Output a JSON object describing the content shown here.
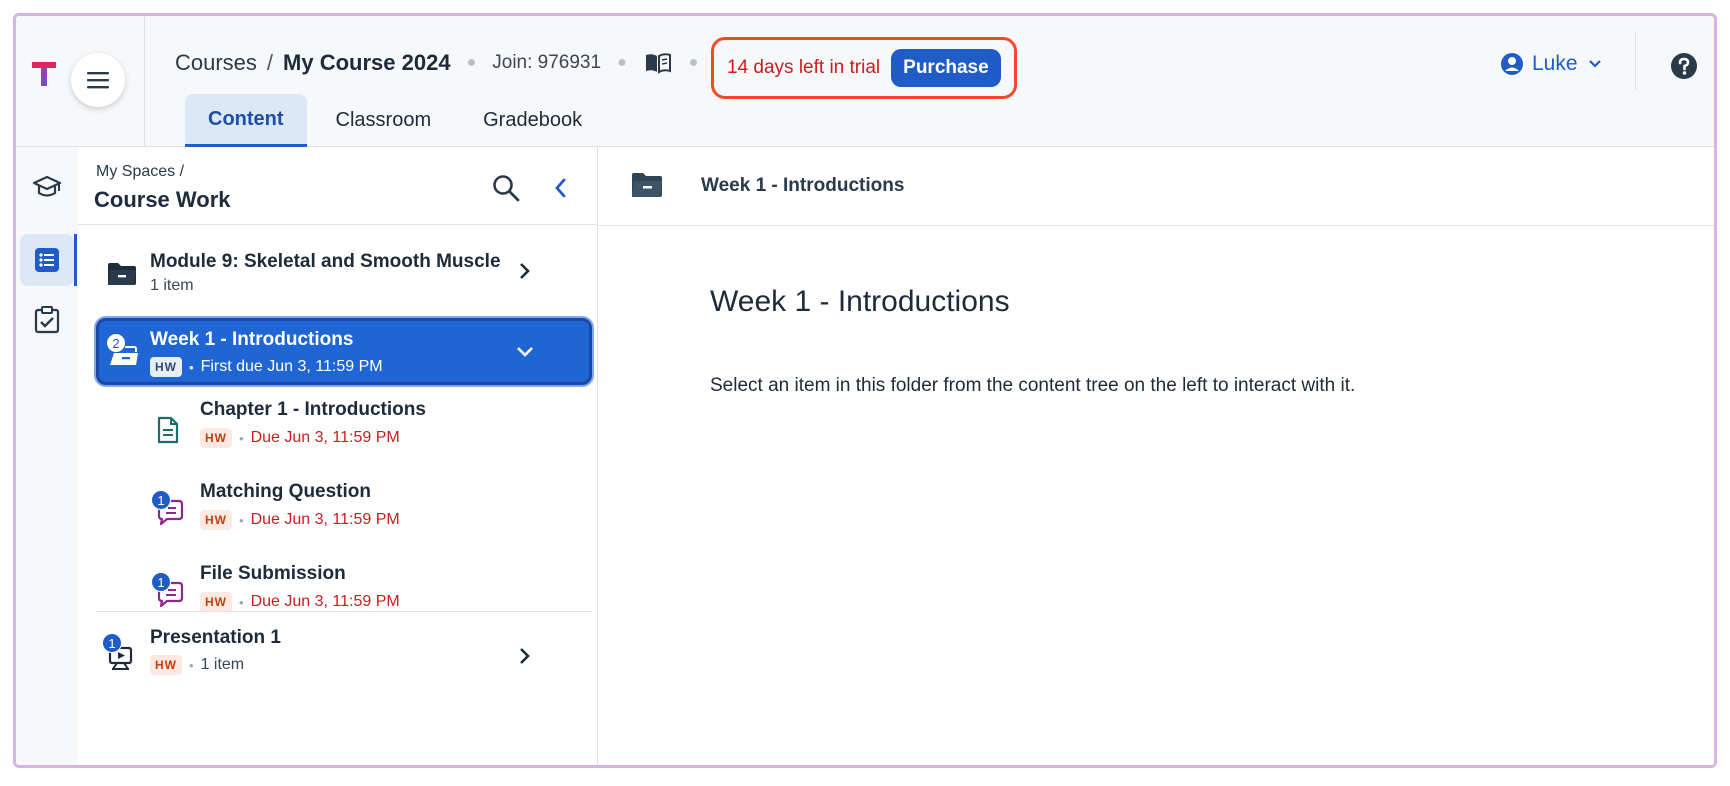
{
  "header": {
    "breadcrumb_courses": "Courses",
    "breadcrumb_sep": "/",
    "course_name": "My Course 2024",
    "join_code": "Join: 976931",
    "trial_text": "14 days left in trial",
    "purchase_label": "Purchase",
    "user_name": "Luke",
    "tabs": [
      {
        "label": "Content",
        "active": true
      },
      {
        "label": "Classroom",
        "active": false
      },
      {
        "label": "Gradebook",
        "active": false
      }
    ]
  },
  "sidebar": {
    "crumb": "My Spaces  /",
    "title": "Course Work",
    "items": [
      {
        "title": "Module 9: Skeletal and Smooth Muscle",
        "meta": "1 item",
        "icon": "folder-icon"
      },
      {
        "title": "Week 1 - Introductions",
        "tag": "HW",
        "meta": "First due Jun 3, 11:59 PM",
        "badge": "2",
        "icon": "open-folder-icon",
        "selected": true
      },
      {
        "title": "Chapter 1 - Introductions",
        "tag": "HW",
        "meta": "Due Jun 3, 11:59 PM",
        "icon": "document-icon"
      },
      {
        "title": "Matching Question",
        "tag": "HW",
        "meta": "Due Jun 3, 11:59 PM",
        "badge": "1",
        "icon": "question-chat-icon"
      },
      {
        "title": "File Submission",
        "tag": "HW",
        "meta": "Due Jun 3, 11:59 PM",
        "badge": "1",
        "icon": "question-chat-icon"
      },
      {
        "title": "Presentation 1",
        "tag": "HW",
        "meta": "1 item",
        "badge": "1",
        "icon": "presentation-icon"
      }
    ]
  },
  "main": {
    "header_label": "Week 1 - Introductions",
    "title": "Week 1 - Introductions",
    "description": "Select an item in this folder from the content tree on the left to interact with it."
  },
  "colors": {
    "accent": "#1f5cc7",
    "selected_row": "#1f66d4",
    "due_red": "#c81e1e",
    "trial_outline": "#ee4a2c"
  }
}
